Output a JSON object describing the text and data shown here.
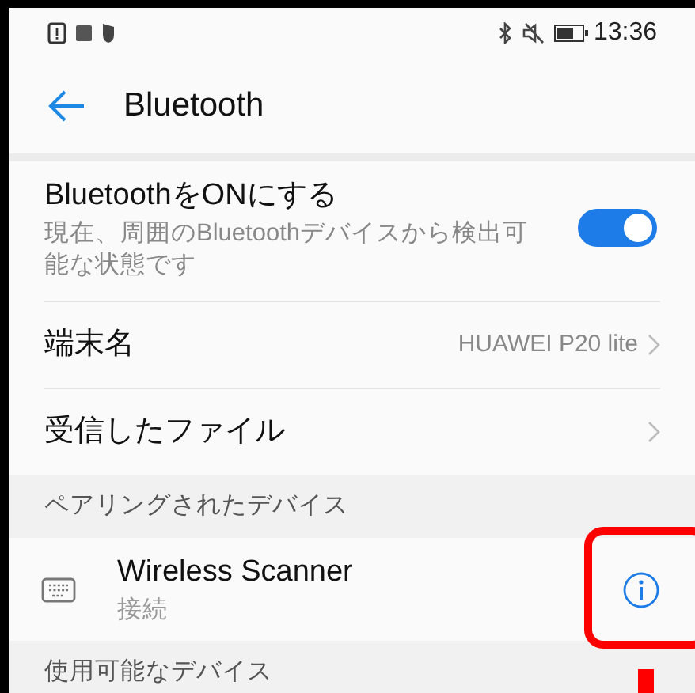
{
  "status_bar": {
    "time": "13:36"
  },
  "header": {
    "title": "Bluetooth"
  },
  "toggle_row": {
    "title": "BluetoothをONにする",
    "subtitle": "現在、周囲のBluetoothデバイスから検出可能な状態です",
    "on": true
  },
  "rows": [
    {
      "title": "端末名",
      "value": "HUAWEI P20 lite"
    },
    {
      "title": "受信したファイル"
    }
  ],
  "paired_section": {
    "title": "ペアリングされたデバイス",
    "devices": [
      {
        "name": "Wireless Scanner",
        "status": "接続",
        "highlighted": true
      }
    ]
  },
  "available_section": {
    "title": "使用可能なデバイス"
  }
}
